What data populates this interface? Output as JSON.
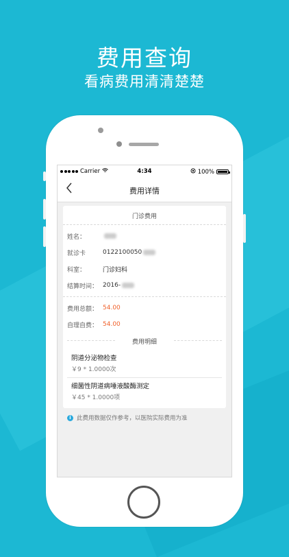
{
  "promo": {
    "headline": "费用查询",
    "subline": "看病费用清清楚楚"
  },
  "statusbar": {
    "carrier": "Carrier",
    "time": "4:34",
    "battery": "100%"
  },
  "navbar": {
    "back_icon": "chevron-left-icon",
    "title": "费用详情"
  },
  "outpatient": {
    "section_title": "门诊费用",
    "fields": [
      {
        "label": "姓名：",
        "value": ""
      },
      {
        "label": "就诊卡",
        "value": "0122100050"
      },
      {
        "label": "科室：",
        "value": "门诊妇科"
      },
      {
        "label": "结算时间：",
        "value": "2016-"
      }
    ],
    "amounts": [
      {
        "label": "费用总额：",
        "value": "54.00"
      },
      {
        "label": "自理自费：",
        "value": "54.00"
      }
    ]
  },
  "details": {
    "title": "费用明细",
    "items": [
      {
        "name": "阴道分泌物检查",
        "price": "￥9 * 1.0000次"
      },
      {
        "name": "细菌性阴道病唾液酸酶测定",
        "price": "￥45 * 1.0000项"
      }
    ]
  },
  "notice": {
    "icon": "info-icon",
    "text": "此费用数据仅作参考，以医院实际费用为准"
  },
  "colors": {
    "background": "#1cb8d3",
    "amount": "#f0612b",
    "info": "#2aa9dd"
  }
}
